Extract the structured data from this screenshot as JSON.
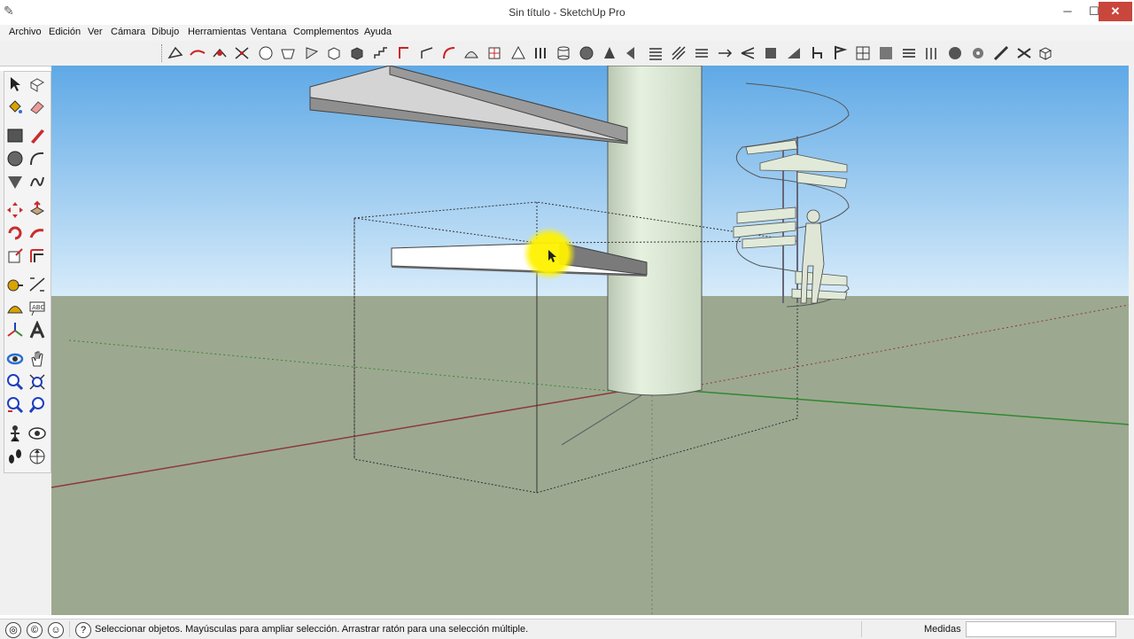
{
  "window": {
    "title": "Sin título - SketchUp Pro",
    "minimize_glyph": "─",
    "maximize_glyph": "☐",
    "close_glyph": "✕"
  },
  "menu": [
    "Archivo",
    "Edición",
    "Ver",
    "Cámara",
    "Dibujo",
    "Herramientas",
    "Ventana",
    "Complementos",
    "Ayuda"
  ],
  "status": {
    "hint": "Seleccionar objetos. Mayúsculas para ampliar selección. Arrastrar ratón para una selección múltiple.",
    "measure_label": "Medidas",
    "measure_value": ""
  },
  "colors": {
    "sky_top": "#5fa9e6",
    "sky_bottom": "#d8ecfa",
    "ground": "#9da891",
    "column": "#d7e6d0",
    "slab_top": "#d4d4d4",
    "slab_side": "#8f8f8f",
    "highlight": "#fff200",
    "axis_red": "#8b3a3a",
    "axis_green": "#2f8a2f"
  }
}
